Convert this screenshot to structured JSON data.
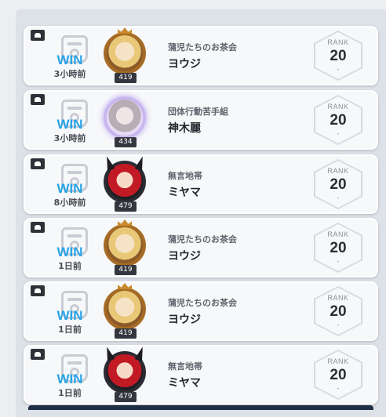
{
  "matches": [
    {
      "result": "WIN",
      "time": "3小時前",
      "level": "419",
      "guild": "蒲児たちのお茶会",
      "player": "ヨウジ",
      "rank_label": "RANK",
      "rank": "20",
      "rank_change": "-",
      "avatar": "blonde-knight-avatar"
    },
    {
      "result": "WIN",
      "time": "3小時前",
      "level": "434",
      "guild": "団体行動苦手組",
      "player": "神木麗",
      "rank_label": "RANK",
      "rank": "20",
      "rank_change": "-",
      "avatar": "silver-hair-avatar"
    },
    {
      "result": "WIN",
      "time": "8小時前",
      "level": "479",
      "guild": "無言地帯",
      "player": "ミヤマ",
      "rank_label": "RANK",
      "rank": "20",
      "rank_change": "-",
      "avatar": "red-hair-horned-avatar"
    },
    {
      "result": "WIN",
      "time": "1日前",
      "level": "419",
      "guild": "蒲児たちのお茶会",
      "player": "ヨウジ",
      "rank_label": "RANK",
      "rank": "20",
      "rank_change": "-",
      "avatar": "blonde-knight-avatar"
    },
    {
      "result": "WIN",
      "time": "1日前",
      "level": "419",
      "guild": "蒲児たちのお茶会",
      "player": "ヨウジ",
      "rank_label": "RANK",
      "rank": "20",
      "rank_change": "-",
      "avatar": "blonde-knight-avatar"
    },
    {
      "result": "WIN",
      "time": "1日前",
      "level": "479",
      "guild": "無言地帯",
      "player": "ミヤマ",
      "rank_label": "RANK",
      "rank": "20",
      "rank_change": "-",
      "avatar": "red-hair-horned-avatar"
    }
  ],
  "colors": {
    "win": "#27a4e8",
    "card": "#f7f8fa",
    "background": "#dde1e8"
  }
}
